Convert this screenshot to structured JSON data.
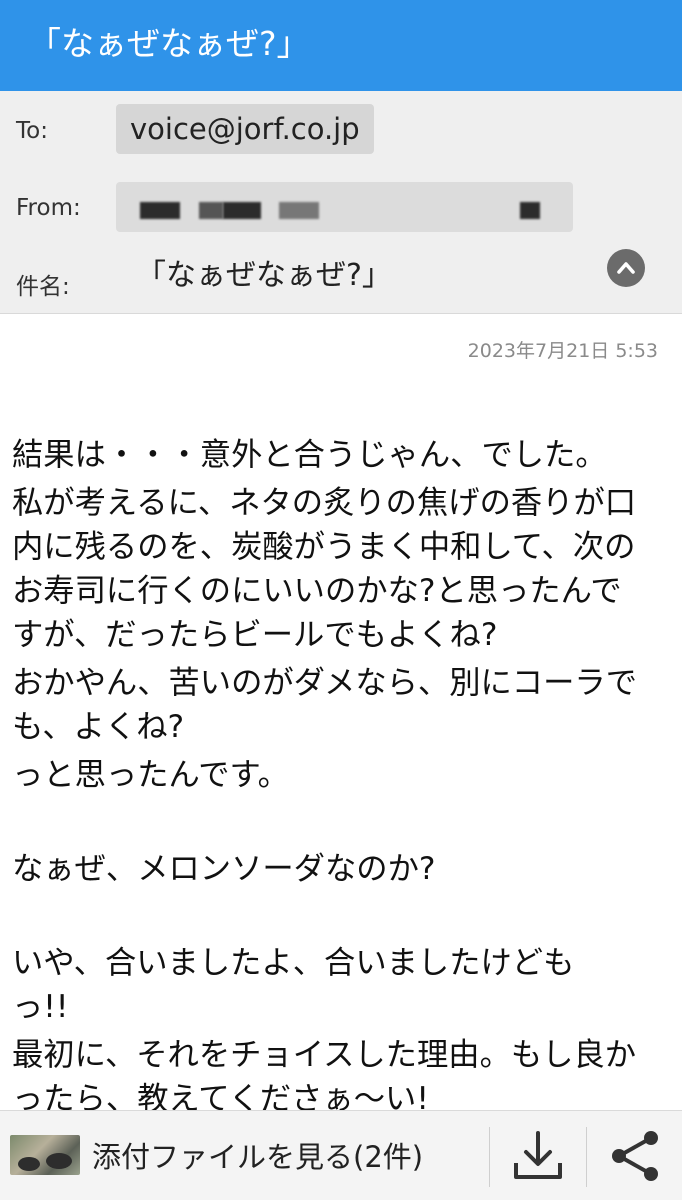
{
  "title_bar": {
    "title": "「なぁぜなぁぜ?」"
  },
  "header": {
    "to_label": "To:",
    "to_address": "voice@jorf.co.jp",
    "from_label": "From:",
    "subject_label": "件名:",
    "subject": "「なぁぜなぁぜ?」"
  },
  "message": {
    "date": "2023年7月21日 5:53",
    "lines": [
      "結果は・・・意外と合うじゃん、でした。",
      "私が考えるに、ネタの炙りの焦げの香りが口\n内に残るのを、炭酸がうまく中和して、次の\nお寿司に行くのにいいのかな?と思ったんで\nすが、だったらビールでもよくね?",
      "おかやん、苦いのがダメなら、別にコーラで\nも、よくね?",
      "っと思ったんです。",
      "",
      "なぁぜ、メロンソーダなのか?",
      "",
      "いや、合いましたよ、合いましたけども\nっ!!",
      "最初に、それをチョイスした理由。もし良か\nったら、教えてくださぁ〜い!"
    ]
  },
  "bottom_bar": {
    "attachment_label": "添付ファイルを見る(2件)"
  },
  "icons": {
    "collapse": "chevron-up-icon",
    "download": "download-icon",
    "share": "share-icon"
  },
  "colors": {
    "accent": "#2f93e9"
  }
}
